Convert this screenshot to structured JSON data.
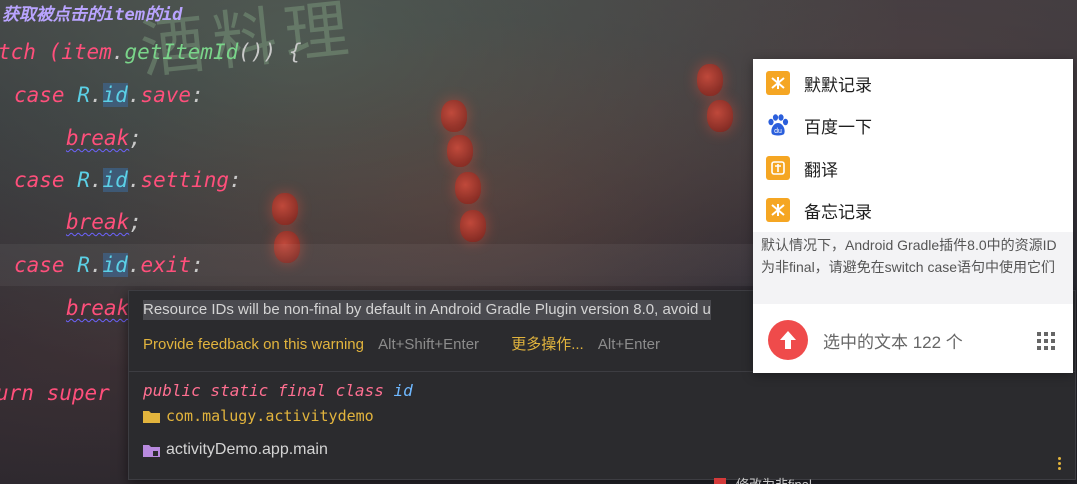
{
  "editor": {
    "comment": "获取被点击的item的id",
    "lines": {
      "l1a": "tch (",
      "l1b": "item",
      "l1c": ".",
      "l1d": "getItemId",
      "l1e": "()) {",
      "l2a": "case ",
      "l2b": "R",
      "l2c": ".",
      "l2d": "id",
      "l2e": ".",
      "l2f": "save",
      "l2g": ":",
      "l3a": "break",
      "l3b": ";",
      "l4a": "case ",
      "l4b": "R",
      "l4c": ".",
      "l4d": "id",
      "l4e": ".",
      "l4f": "setting",
      "l4g": ":",
      "l5a": "break",
      "l5b": ";",
      "l6a": "case ",
      "l6b": "R",
      "l6c": ".",
      "l6d": "id",
      "l6e": ".",
      "l6f": "exit",
      "l6g": ":",
      "l7a": "break",
      "l8a": "urn super"
    },
    "bottom_text": "修改为非final"
  },
  "doc_popup": {
    "warning": "Resource IDs will be non-final by default in Android Gradle Plugin version 8.0, avoid u",
    "feedback_link": "Provide feedback on this warning",
    "feedback_shortcut": "Alt+Shift+Enter",
    "more_actions": "更多操作...",
    "more_shortcut": "Alt+Enter",
    "signature_modifiers": "public static final class ",
    "signature_name": "id",
    "package": "com.malugy.activitydemo",
    "module": "activityDemo.app.main",
    "package_icon": "folder-icon",
    "module_icon": "module-folder-icon"
  },
  "context_menu": {
    "items": [
      {
        "label": "默默记录",
        "icon": "note-icon"
      },
      {
        "label": "百度一下",
        "icon": "baidu-paw-icon"
      },
      {
        "label": "翻译",
        "icon": "translate-icon"
      },
      {
        "label": "备忘记录",
        "icon": "memo-icon"
      }
    ],
    "description": "默认情况下，Android Gradle插件8.0中的资源ID为非final，请避免在switch case语句中使用它们",
    "selected_text": "选中的文本 122 个",
    "colors": {
      "accent_orange": "#f5a623",
      "red_button": "#ef4b4b",
      "baidu_blue": "#2b5fdc"
    }
  }
}
